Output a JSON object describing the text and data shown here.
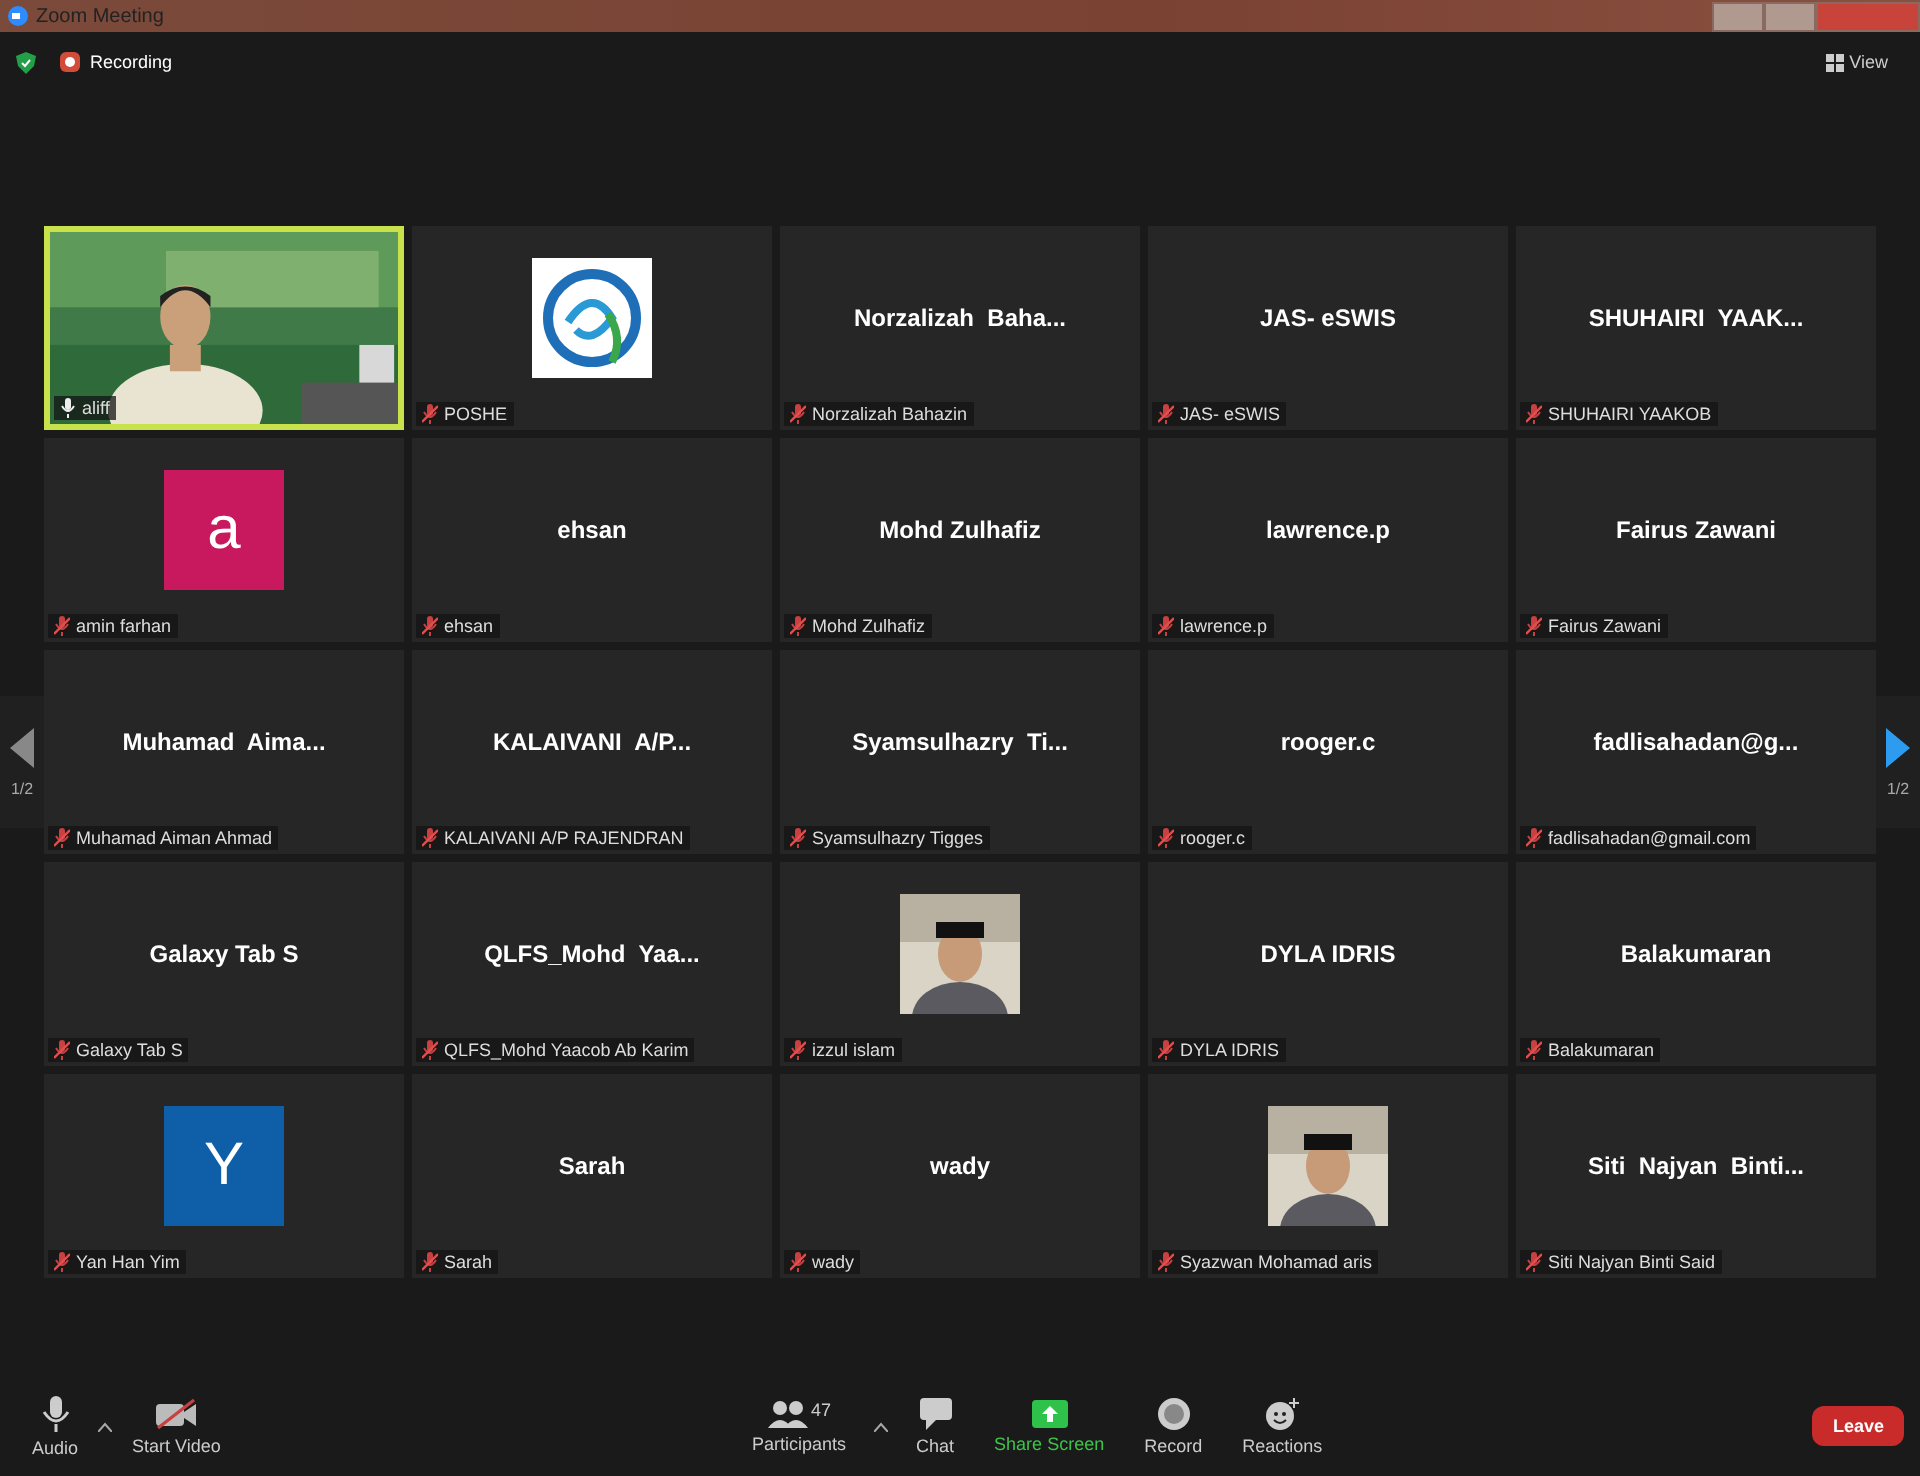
{
  "window": {
    "title": "Zoom Meeting"
  },
  "top_bar": {
    "recording_label": "Recording",
    "view_label": "View"
  },
  "pager": {
    "left": "1/2",
    "right": "1/2"
  },
  "tiles": [
    {
      "kind": "video",
      "name": "aliff",
      "muted": false,
      "speaking": true
    },
    {
      "kind": "logo",
      "name": "POSHE",
      "muted": true,
      "speaking": false
    },
    {
      "kind": "name",
      "display": "Norzalizah  Baha...",
      "name": "Norzalizah Bahazin",
      "muted": true,
      "speaking": false
    },
    {
      "kind": "name",
      "display": "JAS- eSWIS",
      "name": "JAS- eSWIS",
      "muted": true,
      "speaking": false
    },
    {
      "kind": "name",
      "display": "SHUHAIRI  YAAK...",
      "name": "SHUHAIRI YAAKOB",
      "muted": true,
      "speaking": false
    },
    {
      "kind": "avatar",
      "letter": "a",
      "color": "#c8185e",
      "name": "amin farhan",
      "muted": true,
      "speaking": false
    },
    {
      "kind": "name",
      "display": "ehsan",
      "name": "ehsan",
      "muted": true,
      "speaking": false
    },
    {
      "kind": "name",
      "display": "Mohd Zulhafiz",
      "name": "Mohd Zulhafiz",
      "muted": true,
      "speaking": false
    },
    {
      "kind": "name",
      "display": "lawrence.p",
      "name": "lawrence.p",
      "muted": true,
      "speaking": false
    },
    {
      "kind": "name",
      "display": "Fairus Zawani",
      "name": "Fairus Zawani",
      "muted": true,
      "speaking": false
    },
    {
      "kind": "name",
      "display": "Muhamad  Aima...",
      "name": "Muhamad Aiman Ahmad",
      "muted": true,
      "speaking": false
    },
    {
      "kind": "name",
      "display": "KALAIVANI  A/P...",
      "name": "KALAIVANI A/P RAJENDRAN",
      "muted": true,
      "speaking": false
    },
    {
      "kind": "name",
      "display": "Syamsulhazry  Ti...",
      "name": "Syamsulhazry Tigges",
      "muted": true,
      "speaking": false
    },
    {
      "kind": "name",
      "display": "rooger.c",
      "name": "rooger.c",
      "muted": true,
      "speaking": false
    },
    {
      "kind": "name",
      "display": "fadlisahadan@g...",
      "name": "fadlisahadan@gmail.com",
      "muted": true,
      "speaking": false
    },
    {
      "kind": "name",
      "display": "Galaxy Tab S",
      "name": "Galaxy Tab S",
      "muted": true,
      "speaking": false
    },
    {
      "kind": "name",
      "display": "QLFS_Mohd  Yaa...",
      "name": "QLFS_Mohd Yaacob Ab Karim",
      "muted": true,
      "speaking": false
    },
    {
      "name": "izzul islam",
      "muted": true,
      "speaking": false
    },
    {
      "kind": "name",
      "display": "DYLA IDRIS",
      "name": "DYLA IDRIS",
      "muted": true,
      "speaking": false
    },
    {
      "kind": "name",
      "display": "Balakumaran",
      "name": "Balakumaran",
      "muted": true,
      "speaking": false
    },
    {
      "kind": "avatar",
      "letter": "Y",
      "color": "#0f5ea8",
      "name": "Yan Han Yim",
      "muted": true,
      "speaking": false
    },
    {
      "kind": "name",
      "display": "Sarah",
      "name": "Sarah",
      "muted": true,
      "speaking": false
    },
    {
      "kind": "name",
      "display": "wady",
      "name": "wady",
      "muted": true,
      "speaking": false
    },
    {
      "name": "Syazwan Mohamad aris",
      "muted": true,
      "speaking": false
    },
    {
      "kind": "name",
      "display": "Siti  Najyan  Binti...",
      "name": "Siti Najyan Binti Said",
      "muted": true,
      "speaking": false
    }
  ],
  "toolbar": {
    "left": [
      {
        "kind": "audio",
        "label": "Audio"
      },
      {
        "kind": "video",
        "label": "Start Video"
      }
    ],
    "center": [
      {
        "kind": "participants",
        "label": "Participants",
        "count": "47",
        "active": false
      },
      {
        "kind": "chat",
        "label": "Chat",
        "active": false
      },
      {
        "kind": "share",
        "label": "Share Screen",
        "active": true
      },
      {
        "kind": "record",
        "label": "Record",
        "active": false
      },
      {
        "kind": "reactions",
        "label": "Reactions",
        "active": false
      }
    ],
    "leave": "Leave"
  }
}
